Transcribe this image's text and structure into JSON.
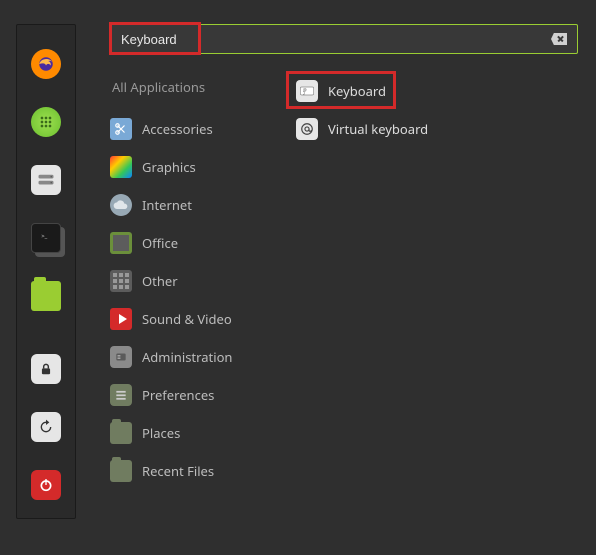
{
  "search": {
    "value": "Keyboard"
  },
  "categories": {
    "all": "All Applications",
    "items": [
      {
        "label": "Accessories"
      },
      {
        "label": "Graphics"
      },
      {
        "label": "Internet"
      },
      {
        "label": "Office"
      },
      {
        "label": "Other"
      },
      {
        "label": "Sound & Video"
      },
      {
        "label": "Administration"
      },
      {
        "label": "Preferences"
      },
      {
        "label": "Places"
      },
      {
        "label": "Recent Files"
      }
    ]
  },
  "results": [
    {
      "label": "Keyboard",
      "icon": "keyboard"
    },
    {
      "label": "Virtual keyboard",
      "icon": "at"
    }
  ],
  "sidebar": {
    "items": [
      {
        "name": "firefox-icon"
      },
      {
        "name": "apps-icon"
      },
      {
        "name": "disks-icon"
      },
      {
        "name": "terminal-icon"
      },
      {
        "name": "files-icon"
      }
    ],
    "bottom": [
      {
        "name": "lock-icon"
      },
      {
        "name": "reload-icon"
      },
      {
        "name": "power-icon"
      }
    ]
  },
  "highlights": {
    "search": true,
    "result_index": 0
  }
}
